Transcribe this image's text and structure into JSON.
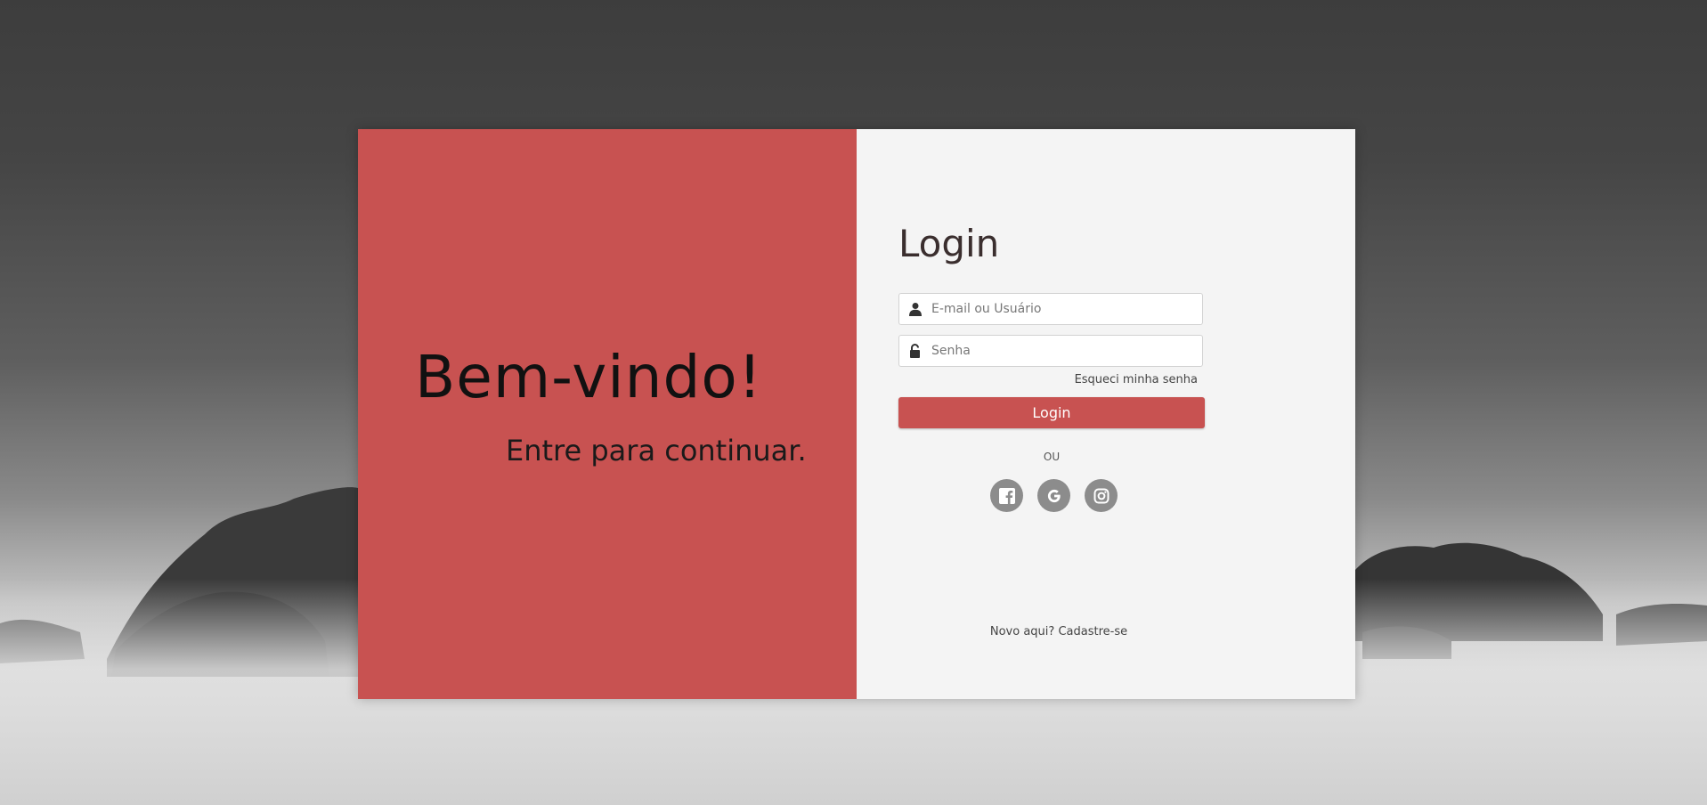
{
  "welcome": {
    "title": "Bem-vindo!",
    "subtitle": "Entre para continuar."
  },
  "login": {
    "title": "Login",
    "email_placeholder": "E-mail ou Usuário",
    "password_placeholder": "Senha",
    "forgot_label": "Esqueci minha senha",
    "button_label": "Login",
    "or_label": "OU",
    "socials": [
      "facebook-icon",
      "google-icon",
      "instagram-icon"
    ],
    "signup_prompt": "Novo aqui?",
    "signup_link": "Cadastre-se"
  },
  "colors": {
    "accent": "#c85251",
    "panel": "#f4f4f4",
    "social": "#8c8c8c"
  }
}
